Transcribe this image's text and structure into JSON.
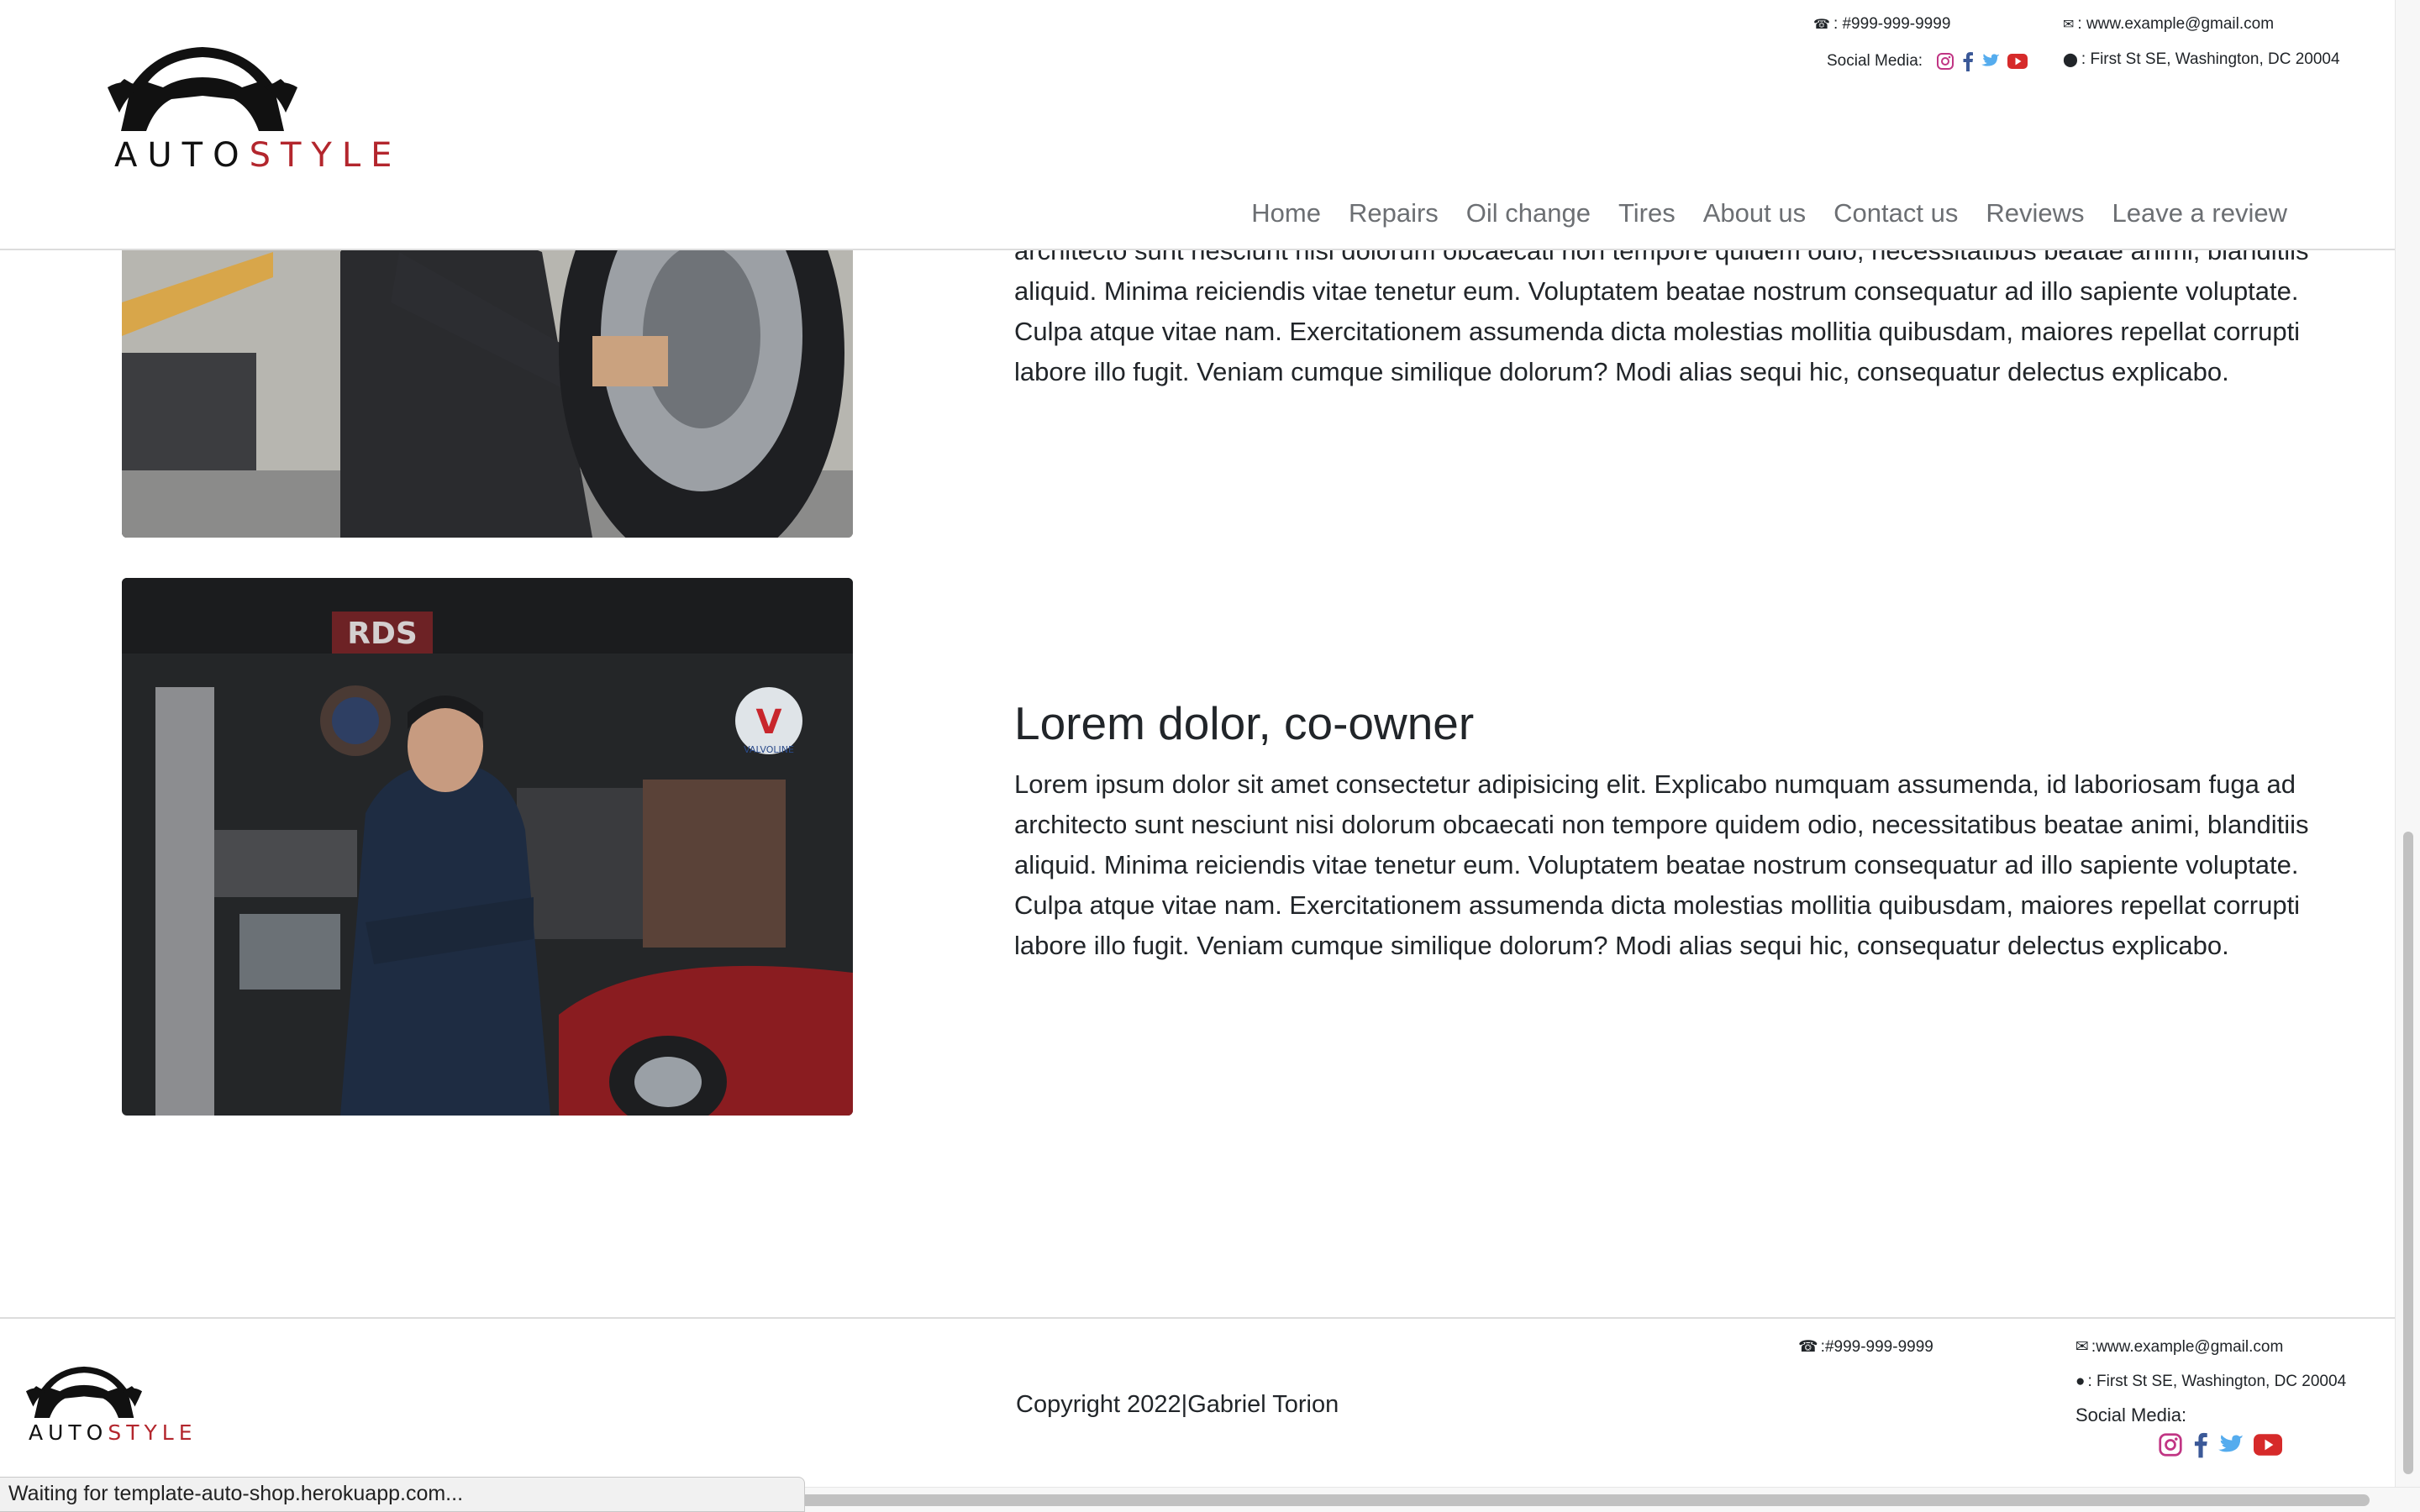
{
  "header": {
    "logo": {
      "word1": "AUTO",
      "word2": "STYLE"
    },
    "phone": ": #999-999-9999",
    "email": ": www.example@gmail.com",
    "address": ": First St SE, Washington, DC 20004",
    "social_label": "Social Media:",
    "social_icons": [
      "instagram-icon",
      "facebook-icon",
      "twitter-icon",
      "youtube-icon"
    ],
    "nav": [
      "Home",
      "Repairs",
      "Oil change",
      "Tires",
      "About us",
      "Contact us",
      "Reviews",
      "Leave a review"
    ]
  },
  "sections": [
    {
      "title": "",
      "lines": [
        "architecto sunt nesciunt nisi dolorum obcaecati non tempore quidem odio, necessitatibus beatae animi, blanditiis",
        "aliquid. Minima reiciendis vitae tenetur eum. Voluptatem beatae nostrum consequatur ad illo sapiente voluptate.",
        "Culpa atque vitae nam. Exercitationem assumenda dicta molestias mollitia quibusdam, maiores repellat corrupti",
        "labore illo fugit. Veniam cumque similique dolorum? Modi alias sequi hic, consequatur delectus explicabo."
      ]
    },
    {
      "title": "Lorem dolor, co-owner",
      "lines": [
        "Lorem ipsum dolor sit amet consectetur adipisicing elit. Explicabo numquam assumenda, id laboriosam fuga ad",
        "architecto sunt nesciunt nisi dolorum obcaecati non tempore quidem odio, necessitatibus beatae animi, blanditiis",
        "aliquid. Minima reiciendis vitae tenetur eum. Voluptatem beatae nostrum consequatur ad illo sapiente voluptate.",
        "Culpa atque vitae nam. Exercitationem assumenda dicta molestias mollitia quibusdam, maiores repellat corrupti",
        "labore illo fugit. Veniam cumque similique dolorum? Modi alias sequi hic, consequatur delectus explicabo."
      ]
    }
  ],
  "photo_signs": {
    "rds": "RDS",
    "valvoline_letter": "V",
    "valvoline_word": "VALVOLINE"
  },
  "footer": {
    "logo": {
      "word1": "AUTO",
      "word2": "STYLE"
    },
    "copyright": "Copyright 2022|Gabriel Torion",
    "phone": ":#999-999-9999",
    "email": ":www.example@gmail.com",
    "address": ": First St SE, Washington, DC 20004",
    "social_label": "Social Media:"
  },
  "status_bar": "Waiting for template-auto-shop.herokuapp.com...",
  "colors": {
    "brand_red": "#b3262d",
    "instagram": "#c13584",
    "facebook": "#3b5998",
    "twitter": "#55acee",
    "youtube": "#d62a2a"
  }
}
